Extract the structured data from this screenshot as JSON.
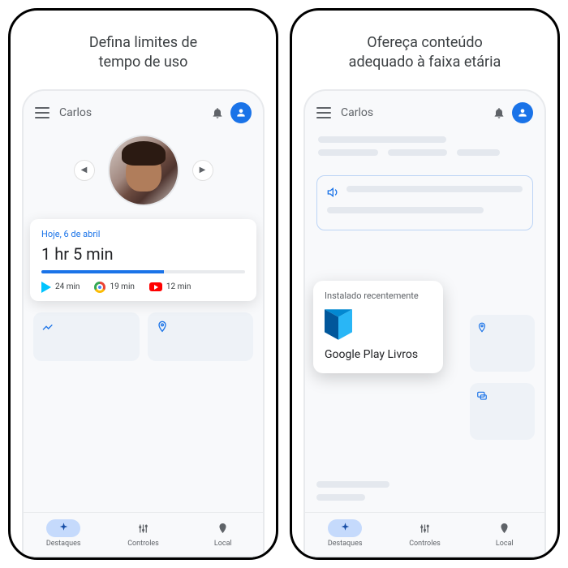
{
  "left": {
    "heading_line1": "Defina limites de",
    "heading_line2": "tempo de uso",
    "header": {
      "name": "Carlos"
    },
    "usage": {
      "date": "Hoje, 6 de abril",
      "total": "1 hr 5 min",
      "apps": [
        {
          "name": "play",
          "time": "24 min"
        },
        {
          "name": "chrome",
          "time": "19 min"
        },
        {
          "name": "youtube",
          "time": "12 min"
        }
      ]
    }
  },
  "right": {
    "heading_line1": "Ofereça conteúdo",
    "heading_line2": "adequado à faixa etária",
    "header": {
      "name": "Carlos"
    },
    "install": {
      "label": "Instalado recentemente",
      "title": "Google Play Livros"
    }
  },
  "nav": {
    "items": [
      {
        "label": "Destaques"
      },
      {
        "label": "Controles"
      },
      {
        "label": "Local"
      }
    ]
  }
}
